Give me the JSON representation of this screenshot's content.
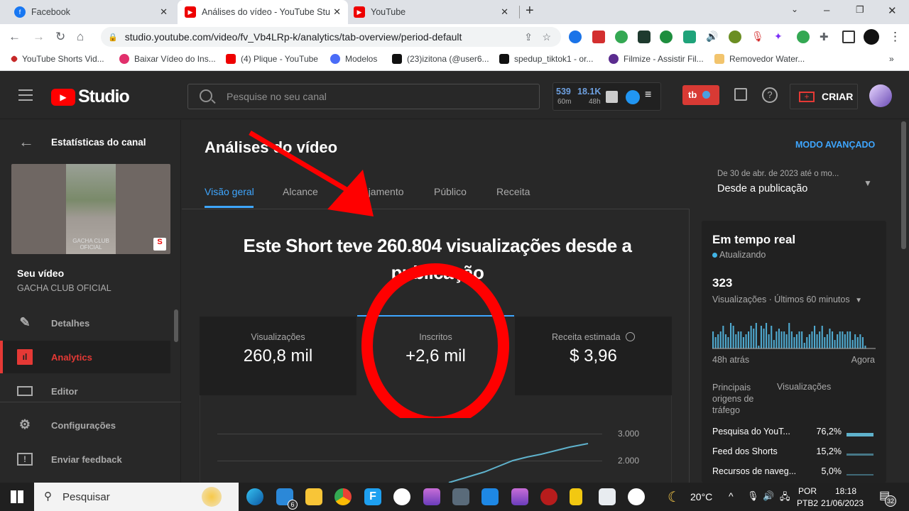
{
  "browser": {
    "tabs": [
      {
        "label": "Facebook",
        "icon": "facebook-icon",
        "active": false
      },
      {
        "label": "Análises do vídeo - YouTube Stu",
        "icon": "youtube-icon",
        "active": true
      },
      {
        "label": "YouTube",
        "icon": "youtube-icon",
        "active": false
      }
    ],
    "new_tab": "+",
    "url": "studio.youtube.com/video/fv_Vb4LRp-k/analytics/tab-overview/period-default",
    "bookmarks": [
      "YouTube Shorts Vid...",
      "Baixar Vídeo do Ins...",
      "(4) Plique - YouTube",
      "Modelos",
      "(23)izitona (@user6...",
      "spedup_tiktok1 - or...",
      "Filmize - Assistir Fil...",
      "Removedor Water..."
    ],
    "bookmarks_more": "»"
  },
  "studio": {
    "logo": "Studio",
    "search_placeholder": "Pesquise no seu canal",
    "stats": {
      "v1": "539",
      "l1": "60m",
      "v2": "18.1K",
      "l2": "48h"
    },
    "create_label": "CRIAR",
    "tubebuddy": "tb"
  },
  "sidebar": {
    "back_label": "Estatísticas do canal",
    "thumb_caption": "GACHA CLUB OFICIAL",
    "video_title": "Seu vídeo",
    "channel": "GACHA CLUB OFICIAL",
    "items": [
      {
        "label": "Detalhes",
        "active": false
      },
      {
        "label": "Analytics",
        "active": true
      },
      {
        "label": "Editor",
        "active": false
      },
      {
        "label": "Configurações",
        "active": false
      },
      {
        "label": "Enviar feedback",
        "active": false
      }
    ]
  },
  "main": {
    "title": "Análises do vídeo",
    "advanced_mode": "MODO AVANÇADO",
    "date_range_sub": "De 30 de abr. de 2023 até o mo...",
    "date_range": "Desde a publicação",
    "tabs": [
      "Visão geral",
      "Alcance",
      "Engajamento",
      "Público",
      "Receita"
    ],
    "active_tab": 0,
    "headline": "Este Short teve 260.804 visualizações desde a publicação",
    "cards": [
      {
        "title": "Visualizações",
        "value": "260,8 mil"
      },
      {
        "title": "Inscritos",
        "value": "+2,6 mil"
      },
      {
        "title": "Receita estimada",
        "value": "$ 3,96"
      }
    ],
    "chart": {
      "y_ticks": [
        "3.000",
        "2.000"
      ]
    }
  },
  "realtime": {
    "title": "Em tempo real",
    "status": "Atualizando",
    "count": "323",
    "metric": "Visualizações · Últimos 60 minutos",
    "x_start": "48h atrás",
    "x_end": "Agora",
    "traffic_header": "Principais origens de tráfego",
    "traffic_col": "Visualizações",
    "sources": [
      {
        "name": "Pesquisa do YouT...",
        "pct": "76,2%"
      },
      {
        "name": "Feed dos Shorts",
        "pct": "15,2%"
      },
      {
        "name": "Recursos de naveg...",
        "pct": "5,0%"
      }
    ],
    "bars": [
      6,
      4,
      5,
      6,
      8,
      5,
      4,
      9,
      8,
      5,
      6,
      6,
      4,
      5,
      6,
      8,
      7,
      9,
      1,
      8,
      7,
      9,
      5,
      8,
      3,
      6,
      7,
      6,
      6,
      5,
      9,
      6,
      4,
      5,
      6,
      6,
      2,
      4,
      5,
      6,
      8,
      5,
      6,
      8,
      4,
      5,
      7,
      6,
      3,
      5,
      6,
      6,
      5,
      6,
      6,
      3,
      5,
      4,
      5,
      4,
      1
    ]
  },
  "taskbar": {
    "search": "Pesquisar",
    "mail_badge": "6",
    "temp": "20°C",
    "lang1": "POR",
    "lang2": "PTB2",
    "time": "18:18",
    "date": "21/06/2023",
    "notif": "32"
  }
}
